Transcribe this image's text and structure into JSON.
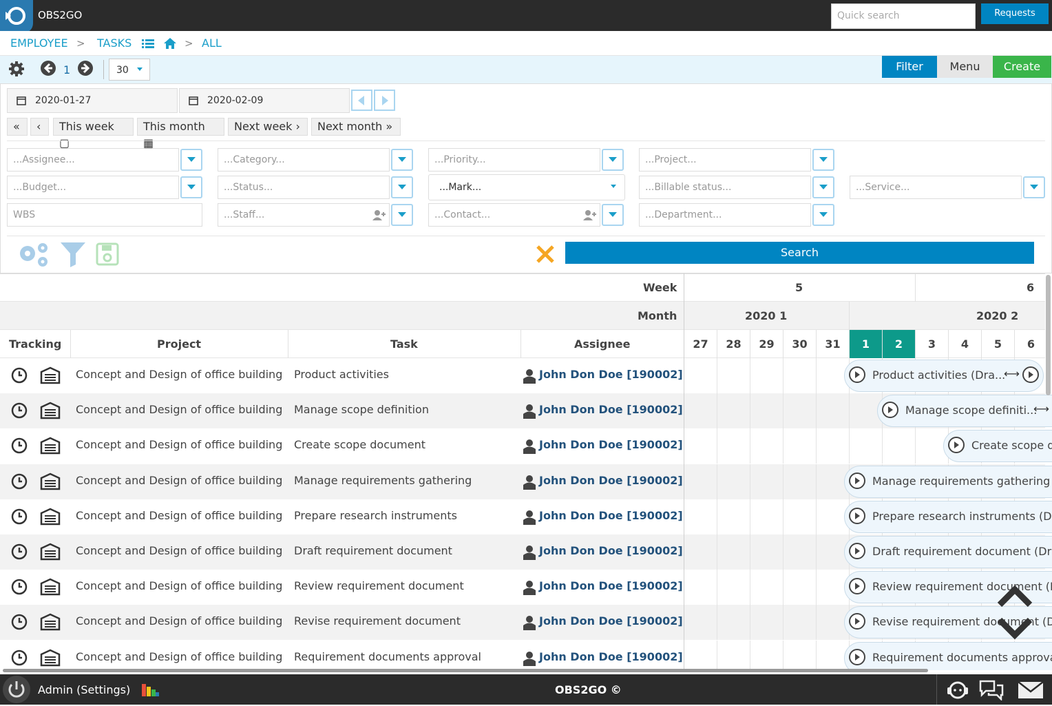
{
  "app": {
    "title": "OBS2GO",
    "quick_search_placeholder": "Quick search",
    "requests_label": "Requests"
  },
  "breadcrumb": {
    "employee": "EMPLOYEE",
    "tasks": "TASKS",
    "all": "ALL",
    "sep": ">"
  },
  "toolbar": {
    "page": "1",
    "page_size": "30",
    "filter_label": "Filter",
    "menu_label": "Menu",
    "create_label": "Create"
  },
  "dates": {
    "from": "2020-01-27",
    "to": "2020-02-09"
  },
  "quicknav": {
    "this_week": "This week",
    "this_month": "This month",
    "next_week": "Next week",
    "next_month": "Next month"
  },
  "filters": {
    "assignee": "...Assignee...",
    "category": "...Category...",
    "priority": "...Priority...",
    "project": "...Project...",
    "budget": "...Budget...",
    "status": "...Status...",
    "mark": "...Mark...",
    "billable": "...Billable status...",
    "service": "...Service...",
    "wbs": "WBS",
    "staff": "...Staff...",
    "contact": "...Contact...",
    "department": "...Department..."
  },
  "search_label": "Search",
  "grid": {
    "week_label": "Week",
    "month_label": "Month",
    "weeks": [
      "5",
      "6"
    ],
    "months": [
      "2020 1",
      "2020 2"
    ],
    "columns": {
      "tracking": "Tracking",
      "project": "Project",
      "task": "Task",
      "assignee": "Assignee"
    },
    "days": [
      "27",
      "28",
      "29",
      "30",
      "31",
      "1",
      "2",
      "3",
      "4",
      "5",
      "6"
    ],
    "highlight_days": [
      "1",
      "2"
    ],
    "rows": [
      {
        "project": "Concept and Design of office building",
        "task": "Product activities",
        "assignee": "John Don Doe [190002]",
        "bar": "Product activities (Dra...",
        "bar_start": 5,
        "bar_resize": true
      },
      {
        "project": "Concept and Design of office building",
        "task": "Manage scope definition",
        "assignee": "John Don Doe [190002]",
        "bar": "Manage scope definiti...",
        "bar_start": 6,
        "bar_resize": true
      },
      {
        "project": "Concept and Design of office building",
        "task": "Create scope document",
        "assignee": "John Don Doe [190002]",
        "bar": "Create scope do...",
        "bar_start": 8,
        "bar_resize": false
      },
      {
        "project": "Concept and Design of office building",
        "task": "Manage requirements gathering",
        "assignee": "John Don Doe [190002]",
        "bar": "Manage requirements gathering (Dra",
        "bar_start": 5,
        "bar_resize": false
      },
      {
        "project": "Concept and Design of office building",
        "task": "Prepare research instruments",
        "assignee": "John Don Doe [190002]",
        "bar": "Prepare research instruments (Draft",
        "bar_start": 5,
        "bar_resize": false
      },
      {
        "project": "Concept and Design of office building",
        "task": "Draft requirement document",
        "assignee": "John Don Doe [190002]",
        "bar": "Draft requirement document (Draft )",
        "bar_start": 5,
        "bar_resize": false
      },
      {
        "project": "Concept and Design of office building",
        "task": "Review requirement document",
        "assignee": "John Don Doe [190002]",
        "bar": "Review requirement document (Draf",
        "bar_start": 5,
        "bar_resize": false
      },
      {
        "project": "Concept and Design of office building",
        "task": "Revise requirement document",
        "assignee": "John Don Doe [190002]",
        "bar": "Revise requirement document (Draft",
        "bar_start": 5,
        "bar_resize": false
      },
      {
        "project": "Concept and Design of office building",
        "task": "Requirement documents approval",
        "assignee": "John Don Doe [190002]",
        "bar": "Requirement documents approval (D",
        "bar_start": 5,
        "bar_resize": false
      }
    ]
  },
  "footer": {
    "user": "Admin (Settings)",
    "brand": "OBS2GO ©"
  },
  "colors": {
    "accent": "#0085c2",
    "create": "#3ab54a",
    "highlight_day": "#0d9a8a",
    "link": "#1a9ec9"
  }
}
